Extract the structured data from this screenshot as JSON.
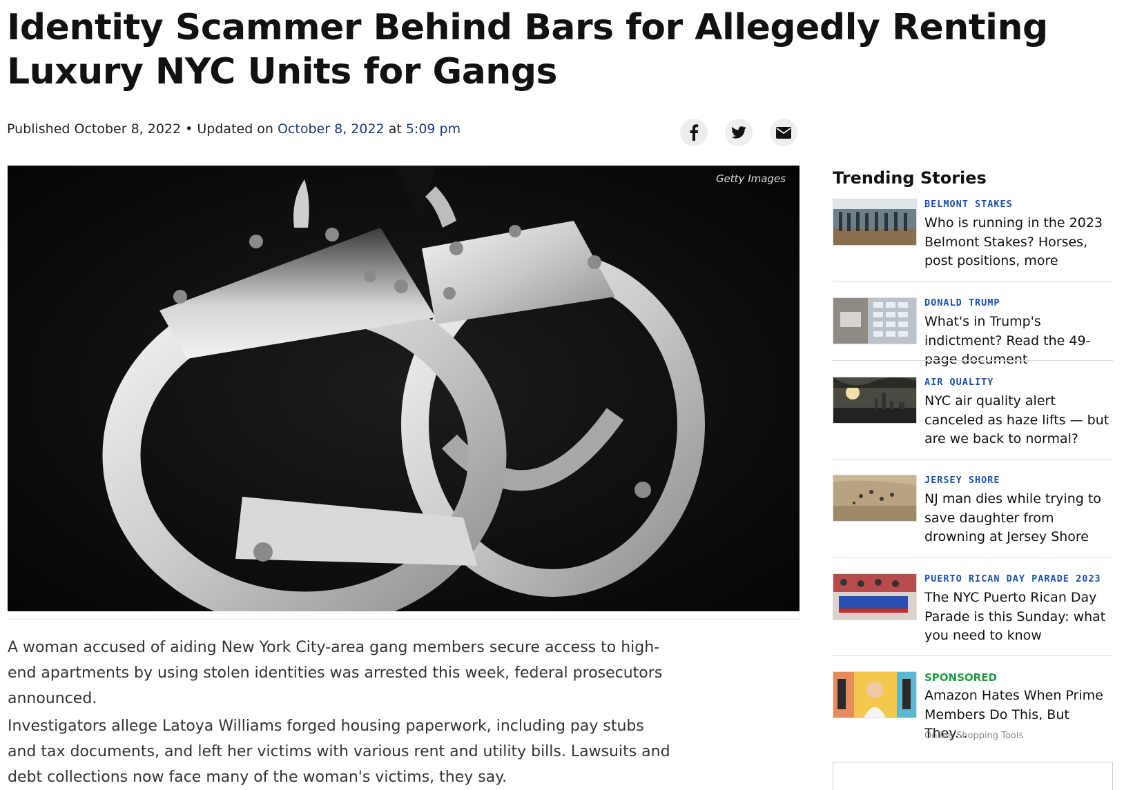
{
  "article": {
    "headline": "Identity Scammer Behind Bars for Allegedly Renting Luxury NYC Units for Gangs",
    "published_prefix": "Published October 8, 2022 • Updated on",
    "updated_date": "October 8, 2022",
    "at": "at",
    "updated_time": "5:09 pm",
    "image_credit": "Getty Images",
    "paragraphs": [
      "A woman accused of aiding New York City-area gang members secure access to high-end apartments by using stolen identities was arrested this week, federal prosecutors announced.",
      "Investigators allege Latoya Williams forged housing paperwork, including pay stubs and tax documents, and left her victims with various rent and utility bills. Lawsuits and debt collections now face many of the woman's victims, they say."
    ]
  },
  "share": {
    "icons": [
      "facebook-icon",
      "twitter-icon",
      "email-icon"
    ]
  },
  "sidebar": {
    "title": "Trending Stories",
    "stories": [
      {
        "category": "BELMONT STAKES",
        "title": "Who is running in the 2023 Belmont Stakes? Horses, post positions, more"
      },
      {
        "category": "DONALD TRUMP",
        "title": "What's in Trump's indictment? Read the 49-page document"
      },
      {
        "category": "AIR QUALITY",
        "title": "NYC air quality alert canceled as haze lifts — but are we back to normal?"
      },
      {
        "category": "JERSEY SHORE",
        "title": "NJ man dies while trying to save daughter from drowning at Jersey Shore"
      },
      {
        "category": "PUERTO RICAN DAY PARADE 2023",
        "title": "The NYC Puerto Rican Day Parade is this Sunday: what you need to know"
      }
    ],
    "sponsored": {
      "label": "SPONSORED",
      "title": "Amazon Hates When Prime Members Do This, But They...",
      "source": "Online Shopping Tools"
    }
  },
  "colors": {
    "category": "#1b4fad",
    "sponsored": "#1a9e3f",
    "link": "#1a3a7a"
  }
}
